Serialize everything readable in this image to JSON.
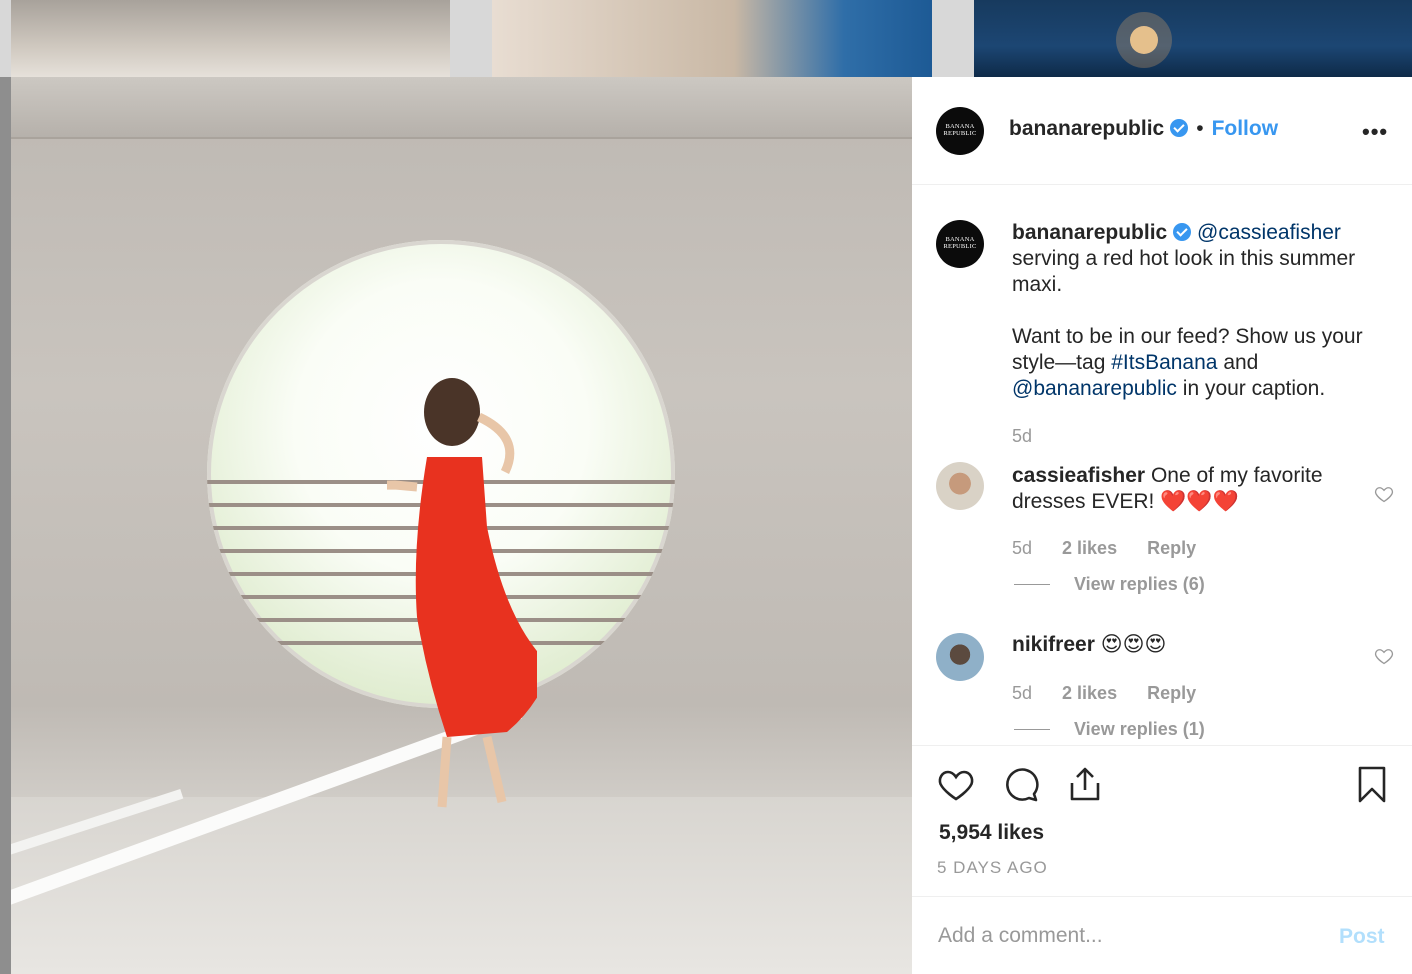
{
  "post": {
    "username": "bananarepublic",
    "logo_text": "BANANA REPUBLIC",
    "follow_label": "Follow",
    "more_label": "•••",
    "separator": "•"
  },
  "caption": {
    "username": "bananarepublic",
    "mention": "@cassieafisher",
    "line1": " serving a red hot look in this summer maxi.",
    "line2_a": "Want to be in our feed? Show us your style—tag ",
    "hashtag": "#ItsBanana",
    "line2_b": " and ",
    "mention2": "@bananarepublic",
    "line2_c": " in your caption.",
    "time": "5d"
  },
  "comments": [
    {
      "username": "cassieafisher",
      "text": "One of my favorite dresses EVER! ❤️❤️❤️",
      "time": "5d",
      "likes": "2 likes",
      "reply_label": "Reply",
      "view_replies": "View replies (6)"
    },
    {
      "username": "nikifreer",
      "text": "😍😍😍",
      "time": "5d",
      "likes": "2 likes",
      "reply_label": "Reply",
      "view_replies": "View replies (1)"
    }
  ],
  "engagement": {
    "likes": "5,954 likes",
    "posted": "5 DAYS AGO"
  },
  "add_comment": {
    "placeholder": "Add a comment...",
    "post_label": "Post"
  },
  "colors": {
    "accent": "#3897f0",
    "link": "#003569",
    "muted": "#999999",
    "dress": "#e8321f"
  }
}
